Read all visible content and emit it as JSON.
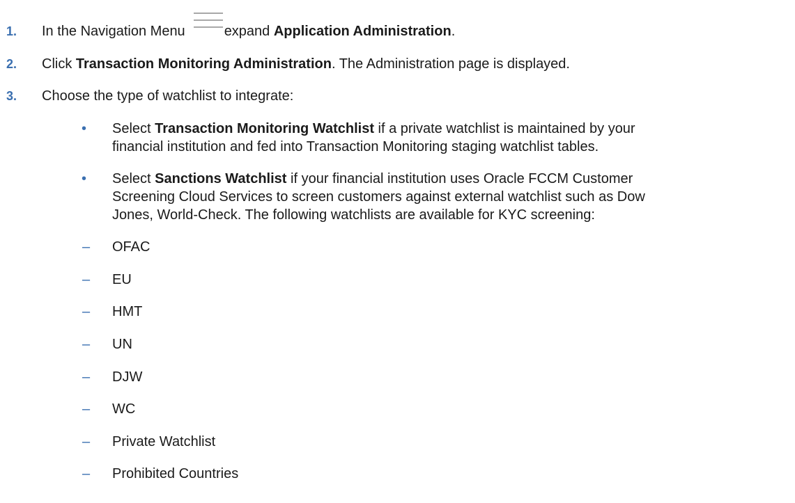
{
  "steps": [
    {
      "num": "1.",
      "pre": "In the Navigation Menu",
      "post": "expand ",
      "bold": "Application Administration",
      "tail": "."
    },
    {
      "num": "2.",
      "pre": "Click ",
      "bold": "Transaction Monitoring Administration",
      "tail": ". The Administration page is displayed."
    },
    {
      "num": "3.",
      "text": "Choose the type of watchlist to integrate:"
    }
  ],
  "icons": {
    "menu": "hamburger-menu-icon"
  },
  "bullets": [
    {
      "pre": "Select ",
      "bold": "Transaction Monitoring Watchlist",
      "line1": " if a private watchlist is maintained by your",
      "line2": "financial institution and fed into Transaction Monitoring staging watchlist tables."
    },
    {
      "pre": "Select ",
      "bold": "Sanctions Watchlist",
      "line1": " if your financial institution uses Oracle FCCM Customer",
      "line2": "Screening Cloud Services to screen customers against external watchlist such as Dow",
      "line3": "Jones, World-Check. The following watchlists are available for KYC screening:"
    }
  ],
  "watchlists": [
    "OFAC",
    "EU",
    "HMT",
    "UN",
    "DJW",
    "WC",
    "Private Watchlist",
    "Prohibited Countries"
  ],
  "colors": {
    "accent": "#3a6fb0",
    "text": "#1a1a1a",
    "icon": "#a8a8a8"
  }
}
